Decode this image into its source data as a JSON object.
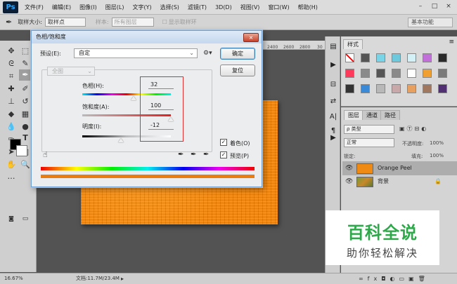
{
  "app": {
    "logo": "Ps",
    "menu": [
      "文件(F)",
      "编辑(E)",
      "图像(I)",
      "图层(L)",
      "文字(Y)",
      "选择(S)",
      "滤镜(T)",
      "3D(D)",
      "视图(V)",
      "窗口(W)",
      "帮助(H)"
    ],
    "win_buttons": [
      "–",
      "□",
      "×"
    ]
  },
  "options": {
    "sample_size_label": "取样大小:",
    "sample_size_value": "取样点",
    "sample_label": "样本:",
    "sample_value": "所有图层",
    "ring_label": "显示取样环",
    "workspace": "基本功能"
  },
  "ruler": {
    "ticks": [
      "2400",
      "2600",
      "2800",
      "30"
    ]
  },
  "dialog": {
    "title": "色相/饱和度",
    "close": "×",
    "preset_label": "预设(E):",
    "preset_value": "自定",
    "channel": "全图",
    "ok": "确定",
    "reset": "复位",
    "hue_label": "色相(H):",
    "hue_value": "32",
    "hue_pos": 0.58,
    "sat_label": "饱和度(A):",
    "sat_value": "100",
    "sat_pos": 1.0,
    "light_label": "明度(I):",
    "light_value": "-12",
    "light_pos": 0.44,
    "colorize_label": "着色(O)",
    "colorize": true,
    "preview_label": "预览(P)",
    "preview": true
  },
  "styles_panel": {
    "tab": "样式",
    "colors": [
      "#ffffff",
      "#555555",
      "#7ad4e8",
      "#6ec9dc",
      "#d2f0f5",
      "#c070d8",
      "#2a2a2a",
      "#ff3a5a",
      "#8a8a8a",
      "#555555",
      "#8a8a8a",
      "#ffffff",
      "#f0a030",
      "#7a7a7a",
      "#333333",
      "#3a8ad8",
      "#b8b8b8",
      "#c8a8a8",
      "#e8a060",
      "#a07860",
      "#503070"
    ]
  },
  "layers_panel": {
    "tabs": [
      "图层",
      "通道",
      "路径"
    ],
    "filter_kind": "ρ 类型",
    "blend_mode": "正常",
    "opacity_label": "不透明度:",
    "opacity": "100%",
    "lock_label": "锁定:",
    "fill_label": "填充:",
    "fill": "100%",
    "layers": [
      {
        "name": "Orange Peel",
        "selected": true
      },
      {
        "name": "背景",
        "selected": false
      }
    ]
  },
  "status": {
    "zoom": "16.67%",
    "doc": "文档:11.7M/23.4M"
  },
  "watermark": {
    "line1": "百科全说",
    "line2": "助你轻松解决"
  }
}
